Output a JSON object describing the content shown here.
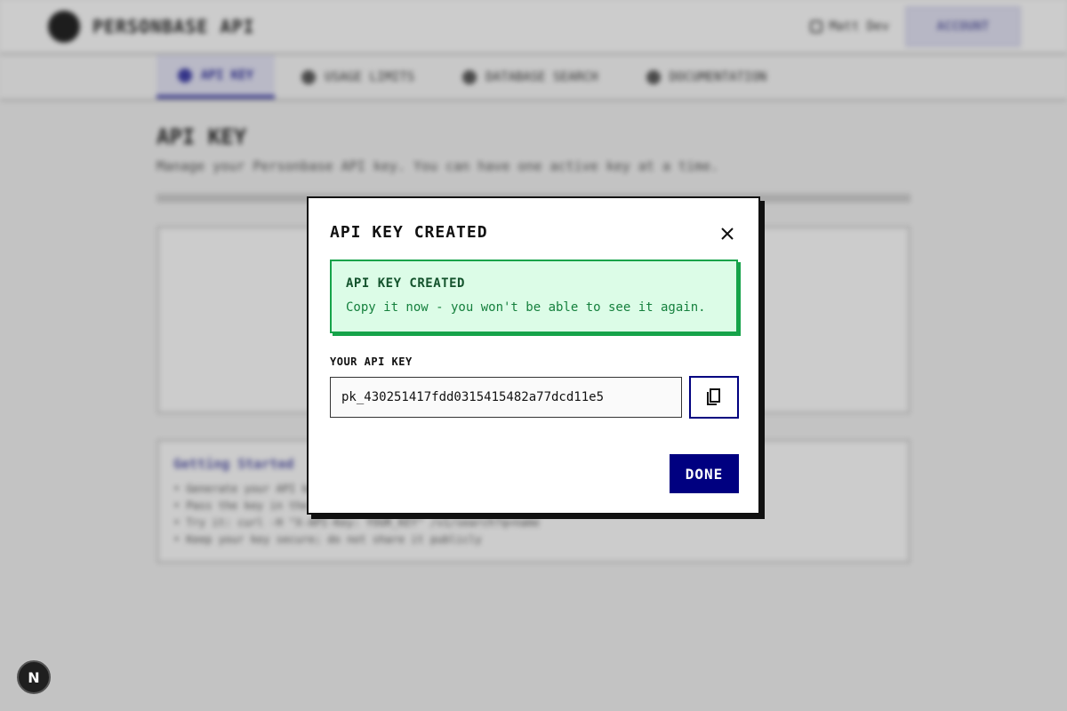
{
  "background": {
    "brand": "PERSONBASE API",
    "user": "Matt Dev",
    "account_button": "ACCOUNT",
    "tabs": [
      {
        "label": "API KEY",
        "icon": "key-icon"
      },
      {
        "label": "USAGE LIMITS",
        "icon": "chart-icon"
      },
      {
        "label": "DATABASE SEARCH",
        "icon": "database-icon"
      },
      {
        "label": "DOCUMENTATION",
        "icon": "book-icon"
      }
    ],
    "page_title": "API KEY",
    "page_subtitle": "Manage your Personbase API key. You can have one active key at a time.",
    "getting_started_title": "Getting Started",
    "getting_started_items": [
      "• Generate your API key above",
      "• Pass the key in the header",
      "• Try it: curl -H \"X-API-Key: YOUR_KEY\" /v1/search?q=name",
      "• Keep your key secure; do not share it publicly"
    ]
  },
  "modal": {
    "title": "API KEY CREATED",
    "success_title": "API KEY CREATED",
    "success_message": "Copy it now - you won't be able to see it again.",
    "field_label": "YOUR API KEY",
    "api_key": "pk_430251417fdd0315415482a77dcd11e5",
    "done_label": "DONE",
    "close_icon": "close-icon",
    "copy_icon": "copy-icon"
  },
  "dev_badge": "N",
  "colors": {
    "accent": "#000080",
    "success_bg": "#dcfce7",
    "success_border": "#16a34a",
    "success_text": "#15803d"
  }
}
